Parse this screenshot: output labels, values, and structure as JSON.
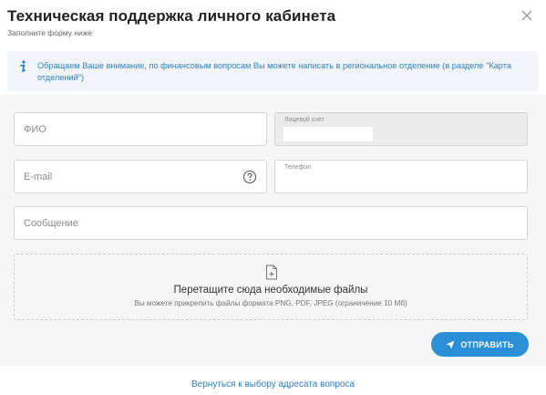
{
  "modal": {
    "title": "Техническая поддержка личного кабинета",
    "subtitle": "Заполните форму ниже"
  },
  "icons": {
    "close": "close-icon",
    "info": "info-icon",
    "help": "question-circle-icon",
    "file": "file-plus-icon",
    "send": "paper-plane-icon"
  },
  "notice": {
    "text": "Обращаем Ваше внимание, по финансовым вопросам Вы можете написать в региональное отделение (в разделе \"Карта отделений\")"
  },
  "form": {
    "fio_placeholder": "ФИО",
    "account_label": "Лицевой счет",
    "email_placeholder": "E-mail",
    "phone_label": "Телефон",
    "message_placeholder": "Сообщение"
  },
  "dropzone": {
    "title": "Перетащите сюда необходимые файлы",
    "hint": "Вы можете прикрепить файлы формата PNG, PDF, JPEG (ограничение 10 Мб)"
  },
  "actions": {
    "submit_label": "ОТПРАВИТЬ",
    "back_link": "Вернуться к выбору адресата вопроса"
  },
  "colors": {
    "accent": "#2a8fd6",
    "notice_text": "#2f7fc1",
    "notice_bg": "#f2f6fa",
    "form_bg": "#f6f6f6"
  }
}
